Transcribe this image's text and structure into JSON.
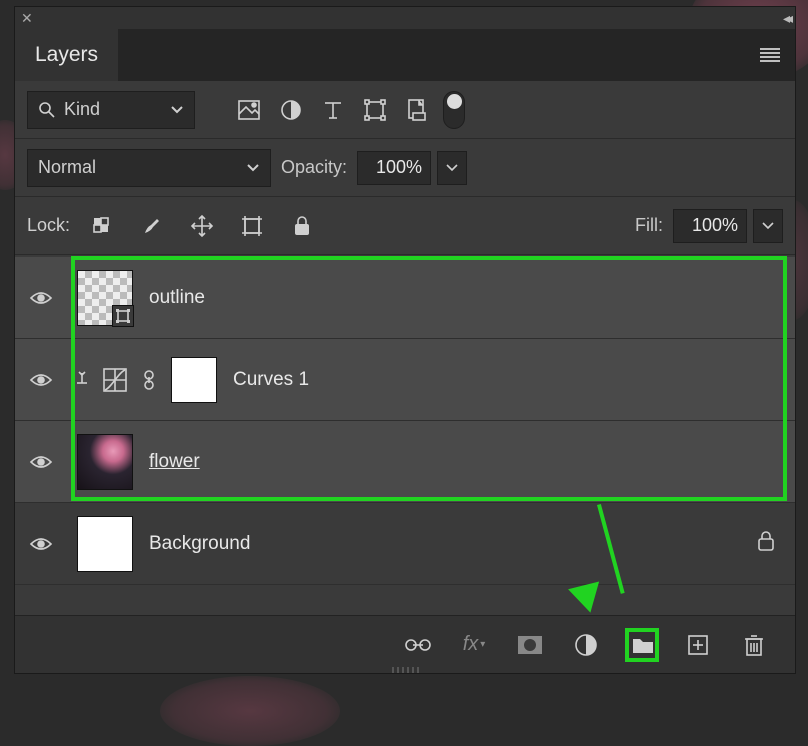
{
  "panel": {
    "tab_label": "Layers"
  },
  "filter": {
    "kind_label": "Kind"
  },
  "blend": {
    "mode": "Normal",
    "opacity_label": "Opacity:",
    "opacity_value": "100%",
    "fill_label": "Fill:",
    "fill_value": "100%"
  },
  "lock": {
    "label": "Lock:"
  },
  "layers": [
    {
      "name": "outline",
      "selected": true,
      "thumb": "checker-shape",
      "has_shape_badge": true
    },
    {
      "name": "Curves 1",
      "selected": true,
      "type": "adjustment",
      "clipped": true
    },
    {
      "name": "flower",
      "selected": true,
      "thumb": "flower",
      "smart_object": true,
      "link_style": true
    },
    {
      "name": "Background",
      "selected": false,
      "thumb": "white",
      "locked": true
    }
  ],
  "icons": {
    "filter_types": [
      "image-layer",
      "adjustment-layer",
      "type-layer",
      "shape-layer",
      "smart-object"
    ],
    "lock_types": [
      "lock-transparency",
      "lock-brush",
      "lock-position",
      "lock-artboard",
      "lock-all"
    ],
    "footer": [
      "link",
      "fx",
      "mask",
      "adjustment",
      "folder",
      "new-layer",
      "trash"
    ]
  }
}
